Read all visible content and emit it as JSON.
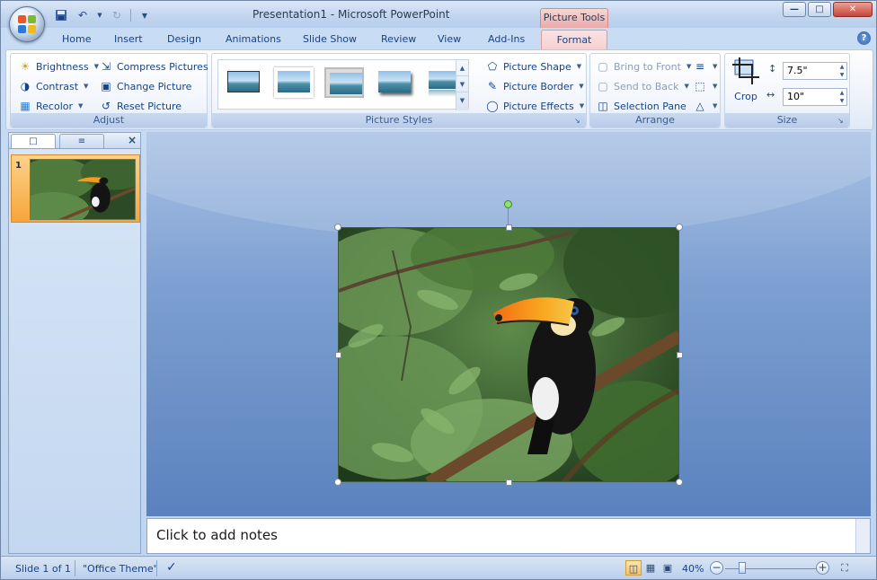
{
  "window": {
    "title": "Presentation1 - Microsoft PowerPoint",
    "context_tab": "Picture Tools"
  },
  "tabs": [
    "Home",
    "Insert",
    "Design",
    "Animations",
    "Slide Show",
    "Review",
    "View",
    "Add-Ins",
    "Format"
  ],
  "active_tab": "Format",
  "ribbon": {
    "adjust": {
      "label": "Adjust",
      "brightness": "Brightness",
      "contrast": "Contrast",
      "recolor": "Recolor",
      "compress": "Compress Pictures",
      "change": "Change Picture",
      "reset": "Reset Picture"
    },
    "styles": {
      "label": "Picture Styles",
      "shape": "Picture Shape",
      "border": "Picture Border",
      "effects": "Picture Effects"
    },
    "arrange": {
      "label": "Arrange",
      "bring_front": "Bring to Front",
      "send_back": "Send to Back",
      "selection_pane": "Selection Pane"
    },
    "size": {
      "label": "Size",
      "crop": "Crop",
      "height": "7.5\"",
      "width": "10\""
    }
  },
  "slides_pane": {
    "slide_number": "1"
  },
  "notes": {
    "placeholder": "Click to add notes"
  },
  "status": {
    "slide": "Slide 1 of 1",
    "theme": "\"Office Theme\"",
    "zoom": "40%"
  },
  "colors": {
    "accent": "#15428b",
    "context_tab": "#e9a9a9",
    "selection": "#f7c25b"
  }
}
